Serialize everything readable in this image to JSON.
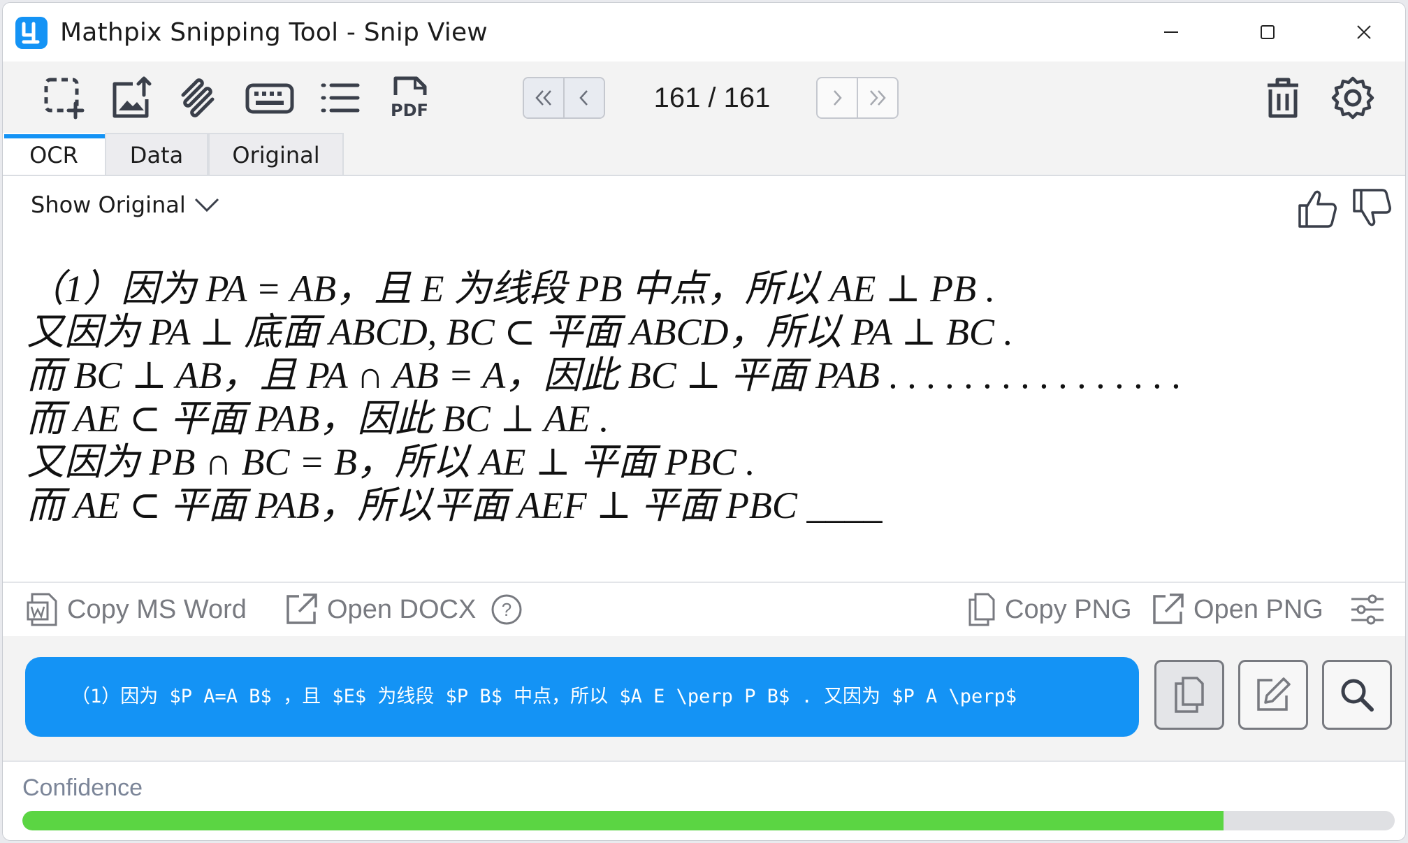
{
  "window": {
    "title": "Mathpix Snipping Tool - Snip View",
    "logo_icon": "mathpix-logo-icon"
  },
  "toolbar": {
    "icons": [
      "screen-snip-icon",
      "upload-image-icon",
      "handwriting-icon",
      "keyboard-icon",
      "list-icon",
      "pdf-icon"
    ],
    "pdf_text": "PDF",
    "page": "161 / 161"
  },
  "tabs": [
    {
      "label": "OCR",
      "active": true
    },
    {
      "label": "Data",
      "active": false
    },
    {
      "label": "Original",
      "active": false
    }
  ],
  "content": {
    "show_original": "Show Original",
    "math_lines": [
      "（1）因为 PA = AB，且 E 为线段 PB 中点，所以 AE ⊥ PB .",
      "又因为 PA ⊥ 底面 ABCD, BC ⊂ 平面 ABCD，所以 PA ⊥ BC .",
      "而 BC ⊥ AB，且 PA ∩ AB = A，因此 BC ⊥ 平面 PAB . . . . . . . . . . . . . . . .",
      "而 AE ⊂ 平面 PAB，因此 BC ⊥ AE .",
      "又因为 PB ∩ BC = B，所以 AE ⊥ 平面 PBC .",
      "而 AE ⊂ 平面 PAB，所以平面 AEF ⊥ 平面 PBC ____"
    ]
  },
  "actions": {
    "copy_ms_word": "Copy MS Word",
    "open_docx": "Open DOCX",
    "help": "?",
    "copy_png": "Copy PNG",
    "open_png": "Open PNG"
  },
  "latex": {
    "text": "（1）因为 $P A=A B$ ，且 $E$ 为线段 $P B$ 中点，所以 $A E \\perp P B$ .  又因为 $P A \\perp$"
  },
  "confidence": {
    "label": "Confidence",
    "value": 0.875
  },
  "colors": {
    "accent": "#1493f5",
    "confidence_fill": "#5bd543"
  }
}
